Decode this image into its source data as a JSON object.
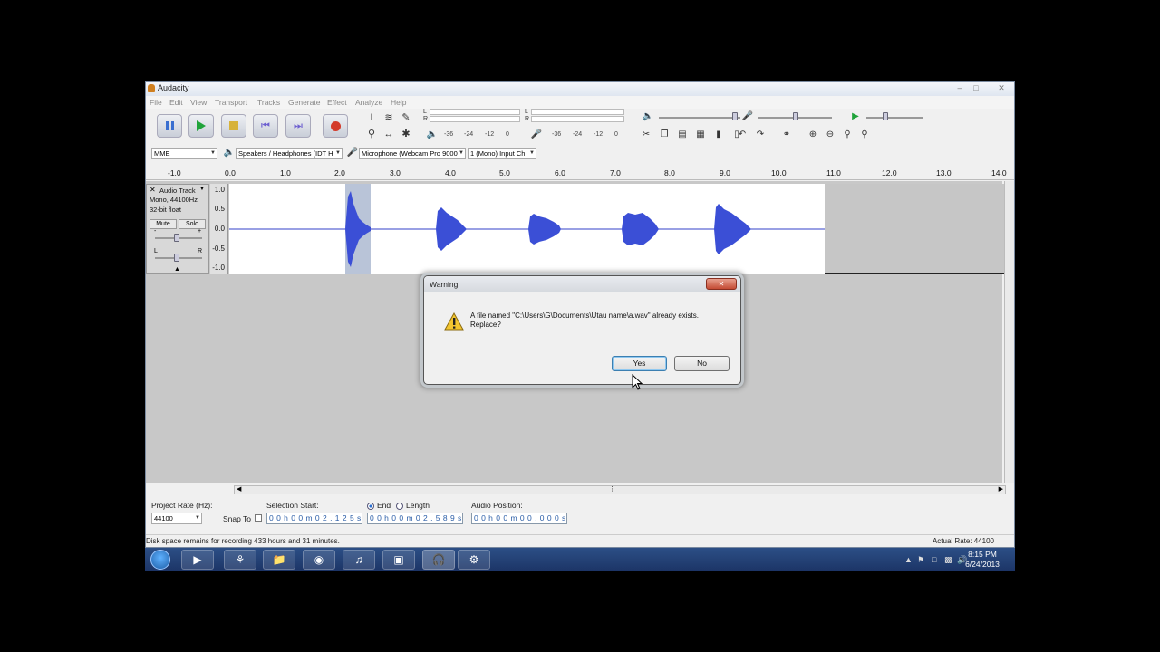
{
  "window": {
    "title": "Audacity",
    "menu": [
      "File",
      "Edit",
      "View",
      "Transport",
      "Tracks",
      "Generate",
      "Effect",
      "Analyze",
      "Help"
    ]
  },
  "meters": {
    "record_scale": [
      "-36",
      "-24",
      "-12",
      "0"
    ],
    "playback_scale": [
      "-36",
      "-24",
      "-12",
      "0"
    ],
    "channel_l": "L",
    "channel_r": "R"
  },
  "device_toolbar": {
    "host": "MME",
    "output_device": "Speakers / Headphones (IDT H",
    "input_device": "Microphone (Webcam Pro 9000",
    "input_channels": "1 (Mono) Input Ch"
  },
  "ruler": {
    "ticks": [
      "-1.0",
      "0.0",
      "1.0",
      "2.0",
      "3.0",
      "4.0",
      "5.0",
      "6.0",
      "7.0",
      "8.0",
      "9.0",
      "10.0",
      "11.0",
      "12.0",
      "13.0",
      "14.0"
    ]
  },
  "track": {
    "name": "Audio Track",
    "info_line1": "Mono, 44100Hz",
    "info_line2": "32-bit float",
    "mute_label": "Mute",
    "solo_label": "Solo",
    "gain_minus": "-",
    "gain_plus": "+",
    "pan_l": "L",
    "pan_r": "R",
    "amplitude_ticks": [
      "1.0",
      "0.5",
      "0.0",
      "-0.5",
      "-1.0"
    ]
  },
  "selection_bar": {
    "project_rate_label": "Project Rate (Hz):",
    "project_rate_value": "44100",
    "snap_to_label": "Snap To",
    "selection_start_label": "Selection Start:",
    "end_label": "End",
    "length_label": "Length",
    "audio_position_label": "Audio Position:",
    "selection_start_value": "0 0 h 0 0 m 0 2 . 1 2 5 s",
    "end_value": "0 0 h 0 0 m 0 2 . 5 8 9 s",
    "audio_position_value": "0 0 h 0 0 m 0 0 . 0 0 0 s"
  },
  "statusbar": {
    "message": "Disk space remains for recording 433 hours and 31 minutes.",
    "actual_rate": "Actual Rate: 44100"
  },
  "taskbar": {
    "time": "8:15 PM",
    "date": "6/24/2013"
  },
  "dialog": {
    "title": "Warning",
    "message": "A file named \"C:\\Users\\G\\Documents\\Utau name\\a.wav\" already exists. Replace?",
    "yes_label": "Yes",
    "no_label": "No"
  }
}
